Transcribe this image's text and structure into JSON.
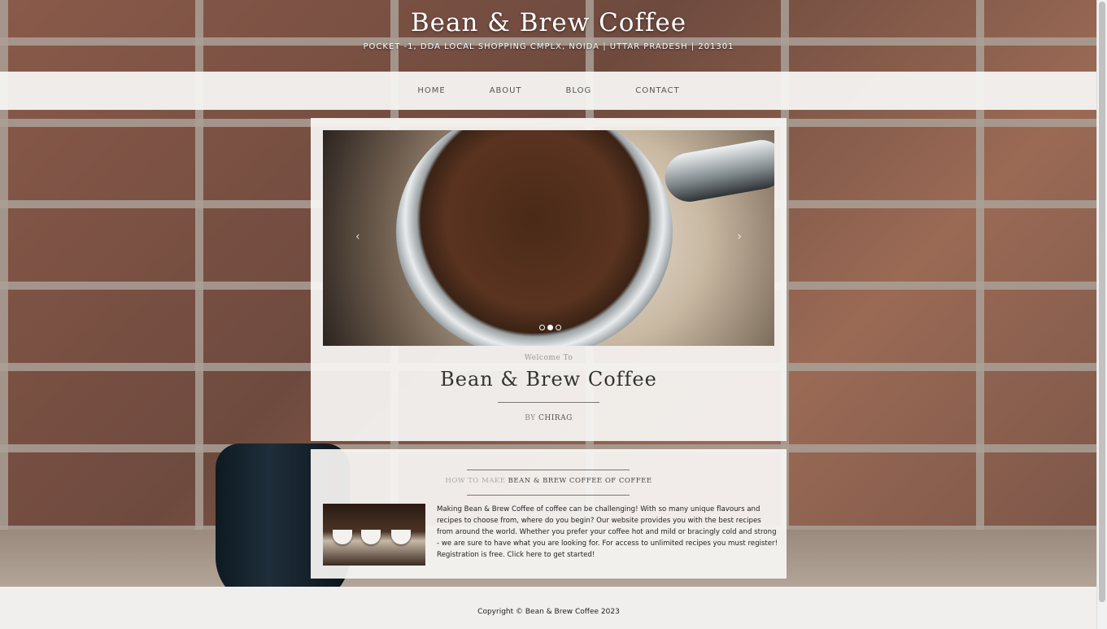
{
  "site": {
    "title": "Bean & Brew Coffee",
    "address": "POCKET -1, DDA LOCAL SHOPPING CMPLX, NOIDA | UTTAR PRADESH | 201301"
  },
  "nav": {
    "items": [
      {
        "label": "HOME"
      },
      {
        "label": "ABOUT"
      },
      {
        "label": "BLOG"
      },
      {
        "label": "CONTACT"
      }
    ]
  },
  "hero": {
    "prev_icon": "chevron-left-icon",
    "next_icon": "chevron-right-icon",
    "prev_glyph": "‹",
    "next_glyph": "›",
    "slide_count": 3,
    "active_slide": 2,
    "welcome": "Welcome To",
    "title": "Bean & Brew Coffee",
    "by_label": "BY",
    "author": "CHIRAG"
  },
  "post": {
    "heading_lead": "HOW TO MAKE",
    "heading_bold": "BEAN & BREW COFFEE OF COFFEE",
    "body": "Making Bean & Brew Coffee of coffee can be challenging! With so many unique flavours and recipes to choose from, where do you begin? Our website provides you with the best recipes from around the world. Whether you prefer your coffee hot and mild or bracingly cold and strong - we are sure to have what you are looking for. For access to unlimited recipes you must register! Registration is free. Click here to get started!"
  },
  "footer": {
    "copyright": "Copyright © Bean & Brew Coffee 2023"
  }
}
